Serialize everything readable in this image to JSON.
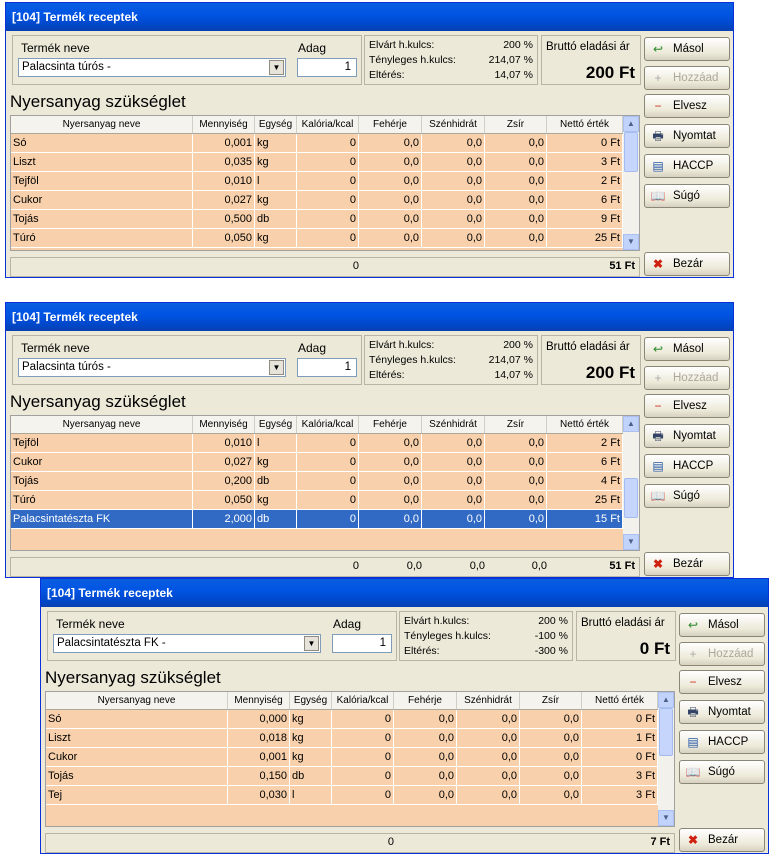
{
  "windows": [
    {
      "title": "[104] Termék receptek",
      "product_label": "Termék neve",
      "product_value": "Palacsinta túrós -",
      "adag_label": "Adag",
      "adag_value": "1",
      "stats": [
        {
          "label": "Elvárt h.kulcs:",
          "value": "200 %"
        },
        {
          "label": "Tényleges h.kulcs:",
          "value": "214,07 %"
        },
        {
          "label": "Eltérés:",
          "value": "14,07 %"
        }
      ],
      "price_label": "Bruttó eladási ár",
      "price_value": "200 Ft",
      "section_title": "Nyersanyag szükséglet",
      "columns": [
        "Nyersanyag neve",
        "Mennyiség",
        "Egység",
        "Kalória/kcal",
        "Fehérje",
        "Szénhidrát",
        "Zsír",
        "Nettó érték"
      ],
      "rows": [
        [
          "Só",
          "0,001",
          "kg",
          "0",
          "0,0",
          "0,0",
          "0,0",
          "0 Ft"
        ],
        [
          "Liszt",
          "0,035",
          "kg",
          "0",
          "0,0",
          "0,0",
          "0,0",
          "3 Ft"
        ],
        [
          "Tejföl",
          "0,010",
          "l",
          "0",
          "0,0",
          "0,0",
          "0,0",
          "2 Ft"
        ],
        [
          "Cukor",
          "0,027",
          "kg",
          "0",
          "0,0",
          "0,0",
          "0,0",
          "6 Ft"
        ],
        [
          "Tojás",
          "0,500",
          "db",
          "0",
          "0,0",
          "0,0",
          "0,0",
          "9 Ft"
        ],
        [
          "Túró",
          "0,050",
          "kg",
          "0",
          "0,0",
          "0,0",
          "0,0",
          "25 Ft"
        ]
      ],
      "footer": {
        "kcal": "0",
        "feh": "",
        "szh": "",
        "zsir": "",
        "netto": "51 Ft"
      },
      "buttons": [
        {
          "label": "Másol",
          "icon": "copy-icon",
          "glyph": "↩",
          "color": "#2a8a2a",
          "disabled": false
        },
        {
          "label": "Hozzáad",
          "icon": "add-icon",
          "glyph": "+",
          "color": "#aaaaaa",
          "disabled": true
        },
        {
          "label": "Elvesz",
          "icon": "remove-icon",
          "glyph": "−",
          "color": "#d03020",
          "disabled": false
        },
        {
          "label": "Nyomtat",
          "icon": "printer-icon",
          "glyph": "🖶",
          "color": "#334466",
          "disabled": false
        },
        {
          "label": "HACCP",
          "icon": "haccp-icon",
          "glyph": "▤",
          "color": "#2255aa",
          "disabled": false
        },
        {
          "label": "Súgó",
          "icon": "help-book-icon",
          "glyph": "📖",
          "color": "#2255aa",
          "disabled": false
        }
      ],
      "close_label": "Bezár"
    },
    {
      "title": "[104] Termék receptek",
      "product_label": "Termék neve",
      "product_value": "Palacsinta túrós -",
      "adag_label": "Adag",
      "adag_value": "1",
      "stats": [
        {
          "label": "Elvárt h.kulcs:",
          "value": "200 %"
        },
        {
          "label": "Tényleges h.kulcs:",
          "value": "214,07 %"
        },
        {
          "label": "Eltérés:",
          "value": "14,07 %"
        }
      ],
      "price_label": "Bruttó eladási ár",
      "price_value": "200 Ft",
      "section_title": "Nyersanyag szükséglet",
      "columns": [
        "Nyersanyag neve",
        "Mennyiség",
        "Egység",
        "Kalória/kcal",
        "Fehérje",
        "Szénhidrát",
        "Zsír",
        "Nettó érték"
      ],
      "rows": [
        [
          "Tejföl",
          "0,010",
          "l",
          "0",
          "0,0",
          "0,0",
          "0,0",
          "2 Ft"
        ],
        [
          "Cukor",
          "0,027",
          "kg",
          "0",
          "0,0",
          "0,0",
          "0,0",
          "6 Ft"
        ],
        [
          "Tojás",
          "0,200",
          "db",
          "0",
          "0,0",
          "0,0",
          "0,0",
          "4 Ft"
        ],
        [
          "Túró",
          "0,050",
          "kg",
          "0",
          "0,0",
          "0,0",
          "0,0",
          "25 Ft"
        ],
        [
          "Palacsintatészta FK",
          "2,000",
          "db",
          "0",
          "0,0",
          "0,0",
          "0,0",
          "15 Ft"
        ]
      ],
      "selected_row": 4,
      "footer": {
        "kcal": "0",
        "feh": "0,0",
        "szh": "0,0",
        "zsir": "0,0",
        "netto": "51 Ft"
      },
      "buttons": [
        {
          "label": "Másol",
          "icon": "copy-icon",
          "glyph": "↩",
          "color": "#2a8a2a",
          "disabled": false
        },
        {
          "label": "Hozzáad",
          "icon": "add-icon",
          "glyph": "+",
          "color": "#aaaaaa",
          "disabled": true
        },
        {
          "label": "Elvesz",
          "icon": "remove-icon",
          "glyph": "−",
          "color": "#d03020",
          "disabled": false
        },
        {
          "label": "Nyomtat",
          "icon": "printer-icon",
          "glyph": "🖶",
          "color": "#334466",
          "disabled": false
        },
        {
          "label": "HACCP",
          "icon": "haccp-icon",
          "glyph": "▤",
          "color": "#2255aa",
          "disabled": false
        },
        {
          "label": "Súgó",
          "icon": "help-book-icon",
          "glyph": "📖",
          "color": "#2255aa",
          "disabled": false
        }
      ],
      "close_label": "Bezár"
    },
    {
      "title": "[104] Termék receptek",
      "product_label": "Termék neve",
      "product_value": "Palacsintatészta FK -",
      "adag_label": "Adag",
      "adag_value": "1",
      "stats": [
        {
          "label": "Elvárt h.kulcs:",
          "value": "200 %"
        },
        {
          "label": "Tényleges h.kulcs:",
          "value": "-100 %"
        },
        {
          "label": "Eltérés:",
          "value": "-300 %"
        }
      ],
      "price_label": "Bruttó eladási ár",
      "price_value": "0 Ft",
      "section_title": "Nyersanyag szükséglet",
      "columns": [
        "Nyersanyag neve",
        "Mennyiség",
        "Egység",
        "Kalória/kcal",
        "Fehérje",
        "Szénhidrát",
        "Zsír",
        "Nettó érték"
      ],
      "rows": [
        [
          "Só",
          "0,000",
          "kg",
          "0",
          "0,0",
          "0,0",
          "0,0",
          "0 Ft"
        ],
        [
          "Liszt",
          "0,018",
          "kg",
          "0",
          "0,0",
          "0,0",
          "0,0",
          "1 Ft"
        ],
        [
          "Cukor",
          "0,001",
          "kg",
          "0",
          "0,0",
          "0,0",
          "0,0",
          "0 Ft"
        ],
        [
          "Tojás",
          "0,150",
          "db",
          "0",
          "0,0",
          "0,0",
          "0,0",
          "3 Ft"
        ],
        [
          "Tej",
          "0,030",
          "l",
          "0",
          "0,0",
          "0,0",
          "0,0",
          "3 Ft"
        ]
      ],
      "footer": {
        "kcal": "0",
        "feh": "",
        "szh": "",
        "zsir": "",
        "netto": "7 Ft"
      },
      "buttons": [
        {
          "label": "Másol",
          "icon": "copy-icon",
          "glyph": "↩",
          "color": "#2a8a2a",
          "disabled": false
        },
        {
          "label": "Hozzáad",
          "icon": "add-icon",
          "glyph": "+",
          "color": "#aaaaaa",
          "disabled": true
        },
        {
          "label": "Elvesz",
          "icon": "remove-icon",
          "glyph": "−",
          "color": "#d03020",
          "disabled": false
        },
        {
          "label": "Nyomtat",
          "icon": "printer-icon",
          "glyph": "🖶",
          "color": "#334466",
          "disabled": false
        },
        {
          "label": "HACCP",
          "icon": "haccp-icon",
          "glyph": "▤",
          "color": "#2255aa",
          "disabled": false
        },
        {
          "label": "Súgó",
          "icon": "help-book-icon",
          "glyph": "📖",
          "color": "#2255aa",
          "disabled": false
        }
      ],
      "close_label": "Bezár"
    }
  ]
}
